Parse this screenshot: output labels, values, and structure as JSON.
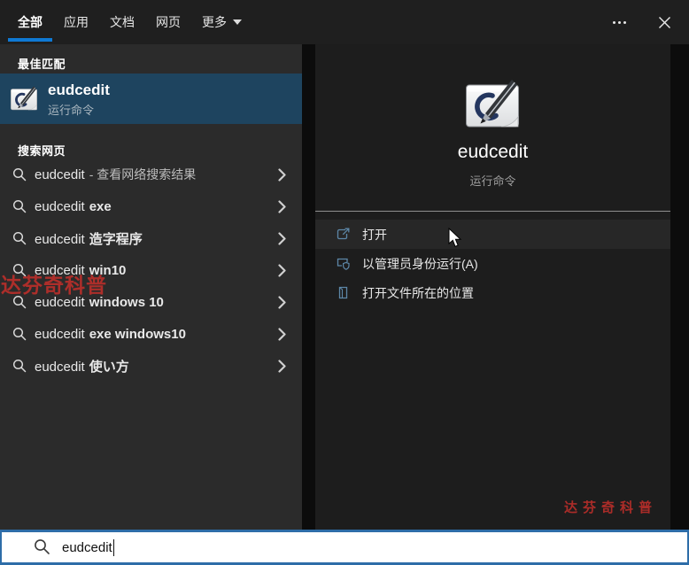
{
  "tabs": {
    "items": [
      {
        "label": "全部",
        "active": true
      },
      {
        "label": "应用",
        "active": false
      },
      {
        "label": "文档",
        "active": false
      },
      {
        "label": "网页",
        "active": false
      },
      {
        "label": "更多",
        "active": false,
        "dropdown": true
      }
    ]
  },
  "best_match": {
    "header": "最佳匹配",
    "item": {
      "name": "eudcedit",
      "type": "运行命令",
      "icon": "private-character-editor-icon"
    }
  },
  "web_search": {
    "header": "搜索网页",
    "items": [
      {
        "query": "eudcedit",
        "suffix": "- 查看网络搜索结果",
        "style": "dim"
      },
      {
        "query": "eudcedit",
        "suffix": "exe",
        "style": "bold"
      },
      {
        "query": "eudcedit",
        "suffix": "造字程序",
        "style": "bold"
      },
      {
        "query": "eudcedit",
        "suffix": "win10",
        "style": "bold"
      },
      {
        "query": "eudcedit",
        "suffix": "windows 10",
        "style": "bold"
      },
      {
        "query": "eudcedit",
        "suffix": "exe windows10",
        "style": "bold"
      },
      {
        "query": "eudcedit",
        "suffix": "使い方",
        "style": "bold"
      }
    ]
  },
  "preview": {
    "name": "eudcedit",
    "type": "运行命令",
    "actions": [
      {
        "label": "打开",
        "icon": "open-icon",
        "hovered": true
      },
      {
        "label": "以管理员身份运行(A)",
        "icon": "admin-shield-icon",
        "hovered": false
      },
      {
        "label": "打开文件所在的位置",
        "icon": "file-location-icon",
        "hovered": false
      }
    ]
  },
  "search_bar": {
    "value": "eudcedit",
    "icon": "search-icon"
  },
  "watermarks": {
    "left": "达芬奇科普",
    "bottom_right": "达芬奇科普"
  },
  "colors": {
    "accent_blue": "#0f79d4",
    "selection_blue": "#1e445f",
    "action_icon_blue": "#5d87a8",
    "watermark_red": "#bb2f2a",
    "search_border_blue": "#2e6da8",
    "left_panel_bg": "#2b2b2b",
    "right_panel_bg": "#1d1d1d",
    "topbar_bg": "#1f1f1f"
  }
}
